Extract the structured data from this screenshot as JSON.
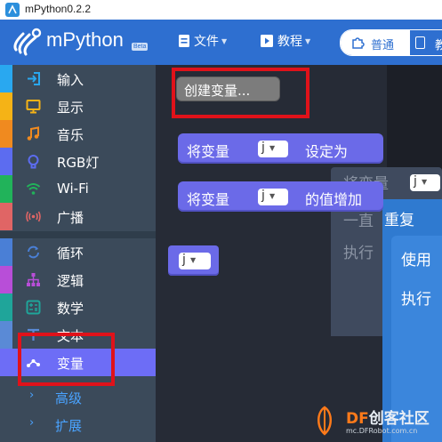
{
  "window": {
    "title": "mPython0.2.2"
  },
  "header": {
    "brand": "mPython",
    "beta": "Beta",
    "menu_file": "文件",
    "menu_tutorial": "教程",
    "mode_normal": "普通",
    "mode_other": "教"
  },
  "sidebar": {
    "categories": [
      {
        "label": "输入",
        "color": "#29a8f0",
        "icon": "input-icon"
      },
      {
        "label": "显示",
        "color": "#f5b316",
        "icon": "display-icon"
      },
      {
        "label": "音乐",
        "color": "#f08a1f",
        "icon": "music-icon"
      },
      {
        "label": "RGB灯",
        "color": "#5c6cf0",
        "icon": "rgb-light-icon"
      },
      {
        "label": "Wi-Fi",
        "color": "#21b35a",
        "icon": "wifi-icon"
      },
      {
        "label": "广播",
        "color": "#e06565",
        "icon": "broadcast-icon"
      },
      {
        "label": "循环",
        "color": "#4a7fd6",
        "icon": "loop-icon"
      },
      {
        "label": "逻辑",
        "color": "#b84ed8",
        "icon": "logic-icon"
      },
      {
        "label": "数学",
        "color": "#1fa59a",
        "icon": "math-icon"
      },
      {
        "label": "文本",
        "color": "#5a8ad6",
        "icon": "text-icon"
      },
      {
        "label": "变量",
        "color": "#6d6df6",
        "icon": "variable-icon"
      }
    ],
    "advanced": "高级",
    "extension": "扩展"
  },
  "flyout": {
    "create_variable": "创建变量...",
    "set_prefix": "将变量",
    "set_suffix": "设定为",
    "change_prefix": "将变量",
    "change_suffix": "的值增加",
    "var_name": "j"
  },
  "workspace": {
    "bg_set_prefix": "将变量",
    "bg_repeat_prefix": "一直",
    "repeat": "重复",
    "do_label": "执行",
    "use_label": "使用",
    "exec_label": "执行"
  },
  "watermark": {
    "brand_df": "DF",
    "brand_rest": "创客社区",
    "url": "mc.DFRobot.com.cn"
  }
}
